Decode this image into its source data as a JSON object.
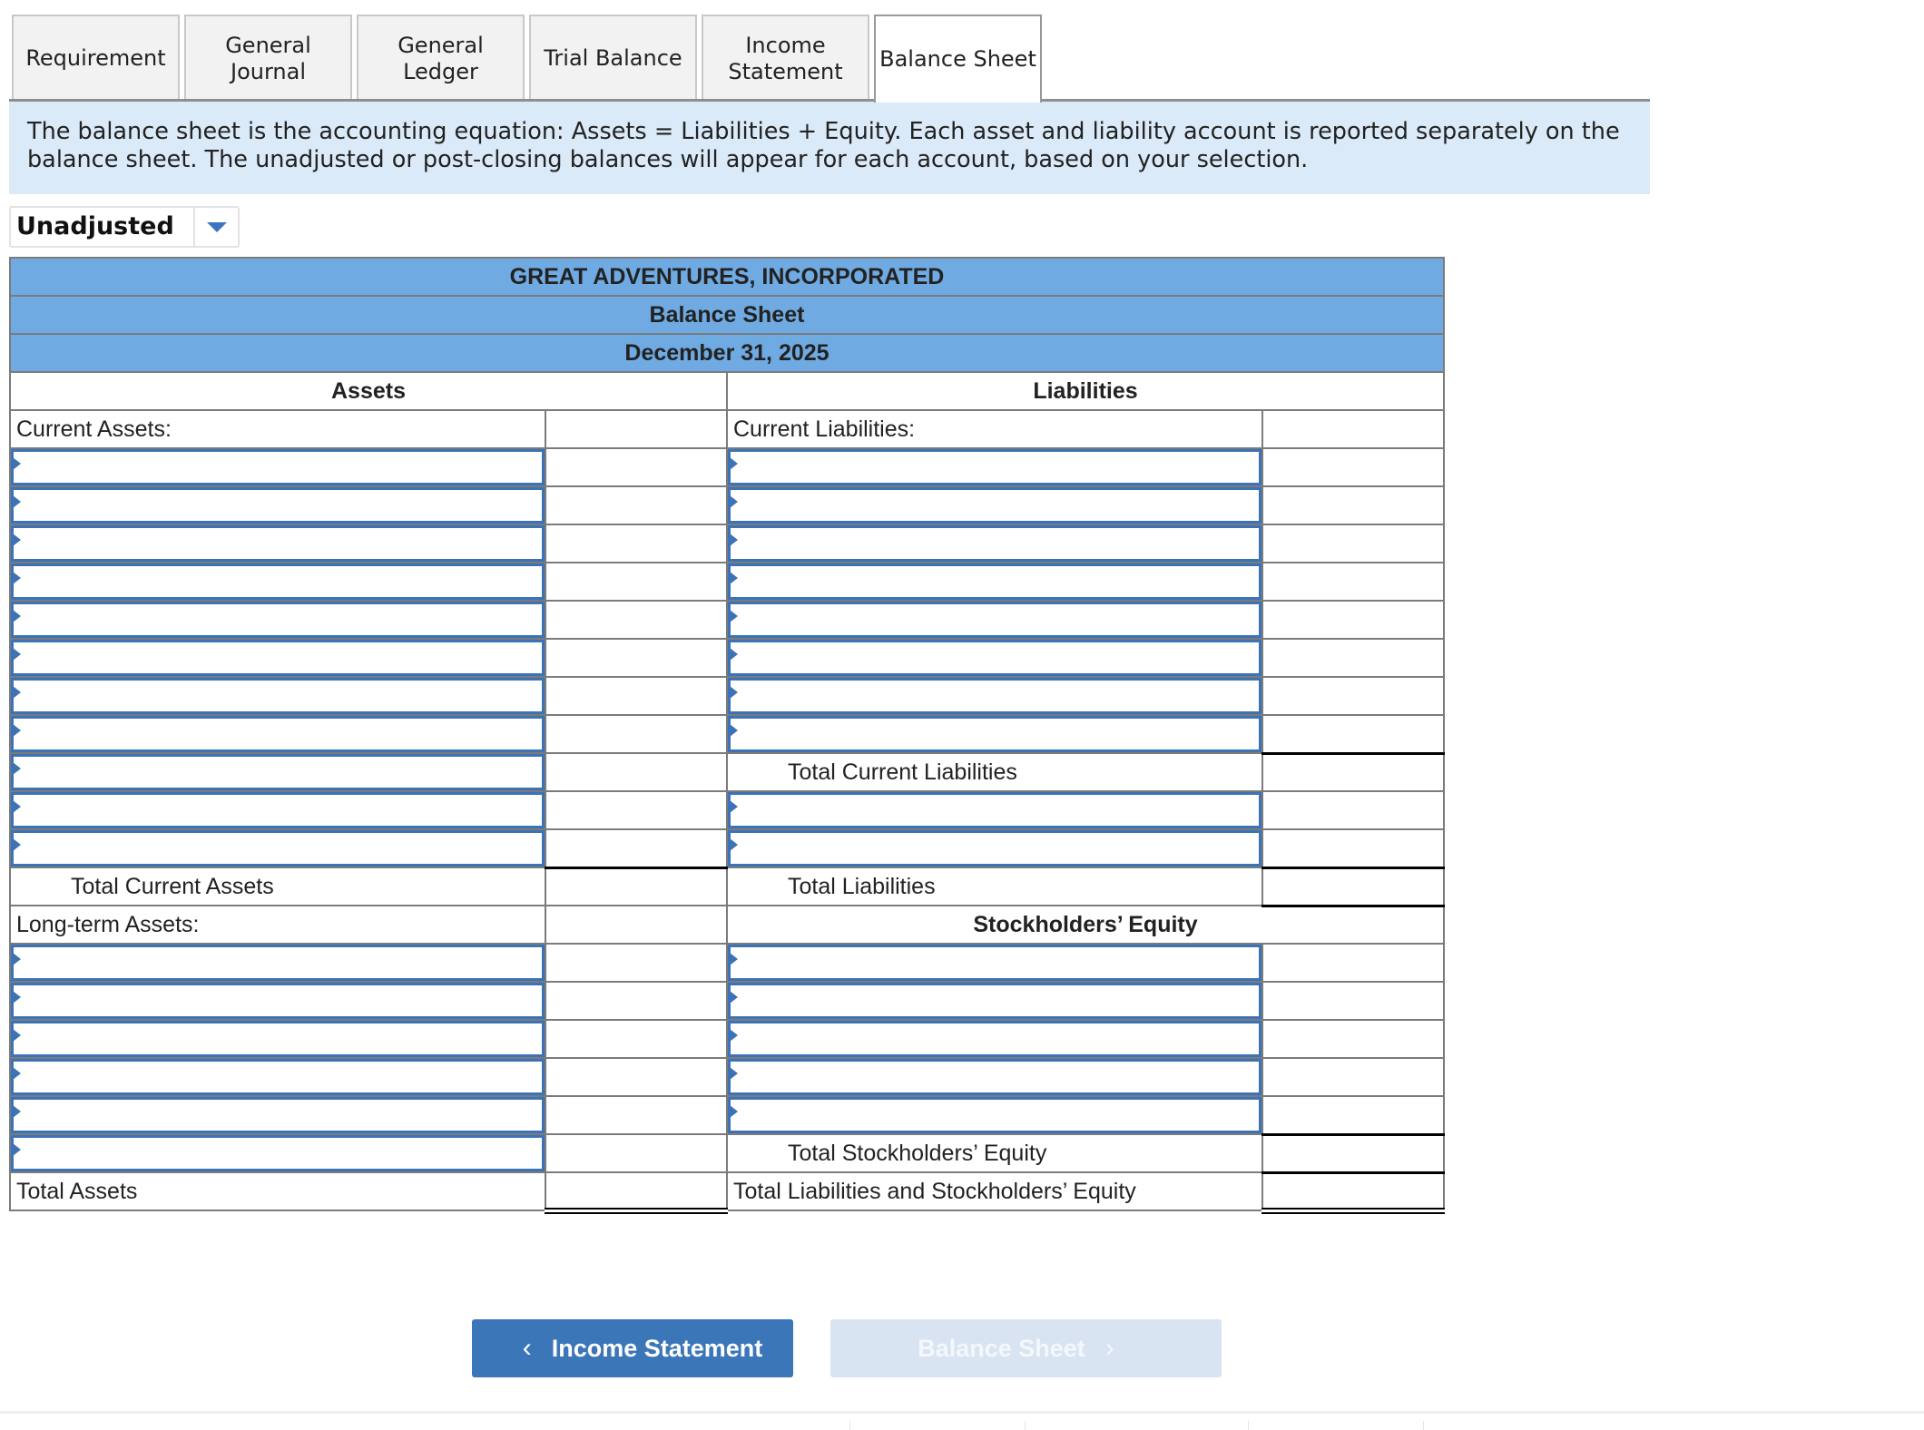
{
  "tabs": [
    {
      "label": "Requirement",
      "active": false
    },
    {
      "label": "General\nJournal",
      "active": false
    },
    {
      "label": "General\nLedger",
      "active": false
    },
    {
      "label": "Trial Balance",
      "active": false
    },
    {
      "label": "Income\nStatement",
      "active": false
    },
    {
      "label": "Balance Sheet",
      "active": true
    }
  ],
  "info_text": "The balance sheet is the accounting equation: Assets = Liabilities + Equity. Each asset and liability account is reported separately on the balance sheet. The unadjusted or post-closing balances will appear for each account, based on your selection.",
  "balance_selector": {
    "selected": "Unadjusted",
    "icon": "chevron-down-icon"
  },
  "statement": {
    "company": "GREAT ADVENTURES, INCORPORATED",
    "title": "Balance Sheet",
    "date": "December 31, 2025",
    "assets_heading": "Assets",
    "liabilities_heading": "Liabilities",
    "current_assets_label": "Current Assets:",
    "current_liabilities_label": "Current Liabilities:",
    "total_current_liabilities_label": "Total Current Liabilities",
    "total_current_assets_label": "Total Current Assets",
    "total_liabilities_label": "Total Liabilities",
    "long_term_assets_label": "Long-term Assets:",
    "stockholders_equity_heading": "Stockholders’ Equity",
    "total_stockholders_equity_label": "Total Stockholders’ Equity",
    "total_assets_label": "Total Assets",
    "total_liabilities_equity_label": "Total Liabilities and Stockholders’ Equity",
    "current_asset_rows": 11,
    "current_liability_rows": 8,
    "other_liability_rows": 2,
    "long_term_asset_rows": 6,
    "equity_rows": 5
  },
  "nav": {
    "prev_label": "Income Statement",
    "next_label": "Balance Sheet",
    "prev_icon": "chevron-left-icon",
    "next_icon": "chevron-right-icon",
    "next_disabled": true
  },
  "colors": {
    "header_bg": "#6faae2",
    "info_bg": "#daeaf8",
    "input_border": "#3b73b6",
    "primary_button": "#3b76b9",
    "disabled_button": "#d8e4f2"
  }
}
